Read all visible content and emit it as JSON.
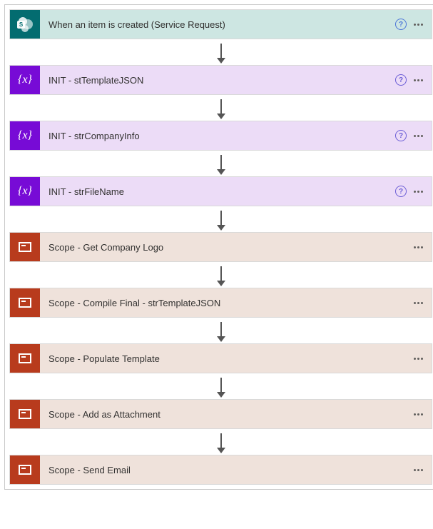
{
  "trigger": {
    "label": "When an item is created (Service Request)"
  },
  "steps": [
    {
      "type": "variable",
      "label": "INIT - stTemplateJSON",
      "help": true
    },
    {
      "type": "variable",
      "label": "INIT - strCompanyInfo",
      "help": true
    },
    {
      "type": "variable",
      "label": "INIT - strFileName",
      "help": true
    },
    {
      "type": "scope",
      "label": "Scope - Get Company Logo",
      "help": false
    },
    {
      "type": "scope",
      "label": "Scope - Compile Final - strTemplateJSON",
      "help": false
    },
    {
      "type": "scope",
      "label": "Scope - Populate Template",
      "help": false
    },
    {
      "type": "scope",
      "label": "Scope - Add as Attachment",
      "help": false
    },
    {
      "type": "scope",
      "label": "Scope - Send Email",
      "help": false
    }
  ],
  "icons": {
    "help_glyph": "?"
  }
}
